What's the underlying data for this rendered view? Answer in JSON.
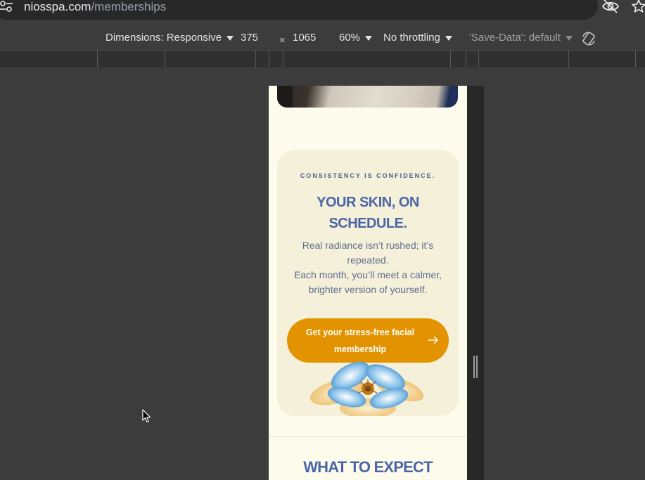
{
  "browser": {
    "url_host": "niosspa.com",
    "url_path": "/memberships"
  },
  "device_toolbar": {
    "dimensions_label": "Dimensions: Responsive",
    "width_value": "375",
    "times_symbol": "×",
    "height_value": "1065",
    "zoom": "60%",
    "throttling": "No throttling",
    "save_data": "'Save-Data': default"
  },
  "page": {
    "eyebrow": "CONSISTENCY IS CONFIDENCE.",
    "headline_line1": "YOUR SKIN, ON",
    "headline_line2": "SCHEDULE.",
    "body_line1": "Real radiance isn’t rushed; it’s repeated.",
    "body_line2": "Each month, you’ll meet a calmer, brighter version of yourself.",
    "cta_label": "Get your stress-free facial membership",
    "next_section_title": "WHAT TO EXPECT"
  },
  "colors": {
    "page_bg": "#fdfbeb",
    "card_bg": "#f4f0d9",
    "accent_blue": "#4b66a6",
    "cta_orange": "#e49300",
    "devtools_bg": "#3c3c3c"
  }
}
